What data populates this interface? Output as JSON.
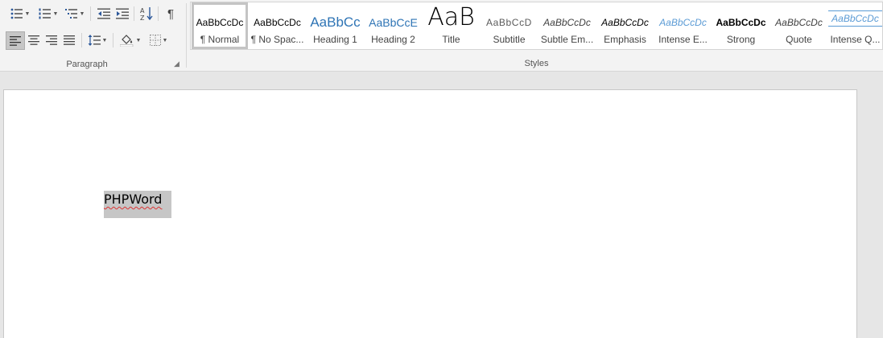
{
  "ribbon": {
    "paragraph_group_label": "Paragraph",
    "styles_group_label": "Styles",
    "dialog_launcher_glyph": "◢"
  },
  "styles": [
    {
      "preview": "AaBbCcDc",
      "name": "¶ Normal",
      "color": "#000000",
      "selected": true
    },
    {
      "preview": "AaBbCcDc",
      "name": "¶ No Spac...",
      "color": "#000000"
    },
    {
      "preview": "AaBbCc",
      "name": "Heading 1",
      "color": "#2e74b5"
    },
    {
      "preview": "AaBbCcE",
      "name": "Heading 2",
      "color": "#2e74b5"
    },
    {
      "preview": "AaB",
      "name": "Title",
      "color": "#000000"
    },
    {
      "preview": "AaBbCcD",
      "name": "Subtitle",
      "color": "#5a5a5a"
    },
    {
      "preview": "AaBbCcDc",
      "name": "Subtle Em...",
      "color": "#404040"
    },
    {
      "preview": "AaBbCcDc",
      "name": "Emphasis",
      "color": "#000000"
    },
    {
      "preview": "AaBbCcDc",
      "name": "Intense E...",
      "color": "#5b9bd5"
    },
    {
      "preview": "AaBbCcDc",
      "name": "Strong",
      "color": "#000000"
    },
    {
      "preview": "AaBbCcDc",
      "name": "Quote",
      "color": "#404040"
    },
    {
      "preview": "AaBbCcDc",
      "name": "Intense Q...",
      "color": "#5b9bd5"
    }
  ],
  "document": {
    "text": "PHPWord"
  },
  "colors": {
    "selection": "#c6c6c6",
    "heading_blue": "#2e74b5",
    "spellcheck_underline": "#d33333"
  }
}
